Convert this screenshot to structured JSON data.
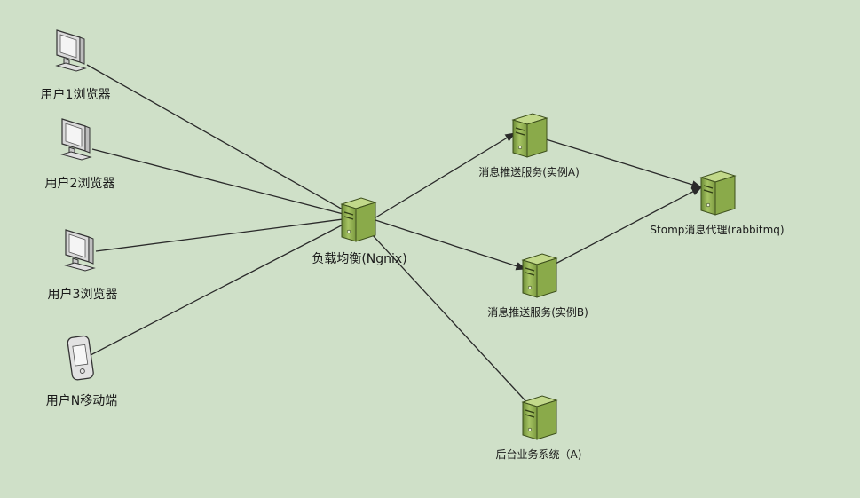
{
  "nodes": {
    "user1": {
      "label": "用户1浏览器",
      "icon": "monitor-icon"
    },
    "user2": {
      "label": "用户2浏览器",
      "icon": "monitor-icon"
    },
    "user3": {
      "label": "用户3浏览器",
      "icon": "monitor-icon"
    },
    "userN": {
      "label": "用户N移动端",
      "icon": "mobile-phone-icon"
    },
    "lb": {
      "label": "负载均衡(Ngnix)",
      "icon": "server-icon"
    },
    "pushA": {
      "label": "消息推送服务(实例A)",
      "icon": "server-icon"
    },
    "pushB": {
      "label": "消息推送服务(实例B)",
      "icon": "server-icon"
    },
    "broker": {
      "label": "Stomp消息代理(rabbitmq)",
      "icon": "server-icon"
    },
    "backend": {
      "label": "后台业务系统（A)",
      "icon": "server-icon"
    }
  },
  "edges": [
    {
      "from": "user1",
      "to": "lb"
    },
    {
      "from": "user2",
      "to": "lb"
    },
    {
      "from": "user3",
      "to": "lb"
    },
    {
      "from": "userN",
      "to": "lb"
    },
    {
      "from": "lb",
      "to": "pushA"
    },
    {
      "from": "lb",
      "to": "pushB"
    },
    {
      "from": "pushA",
      "to": "broker"
    },
    {
      "from": "pushB",
      "to": "broker"
    },
    {
      "from": "backend",
      "to": "lb"
    }
  ],
  "colors": {
    "background": "#cfe0c8",
    "server_light": "#9bbb59",
    "server_dark": "#6b8a35",
    "device_fill": "#e8e8e8",
    "line": "#2a2a2a"
  }
}
